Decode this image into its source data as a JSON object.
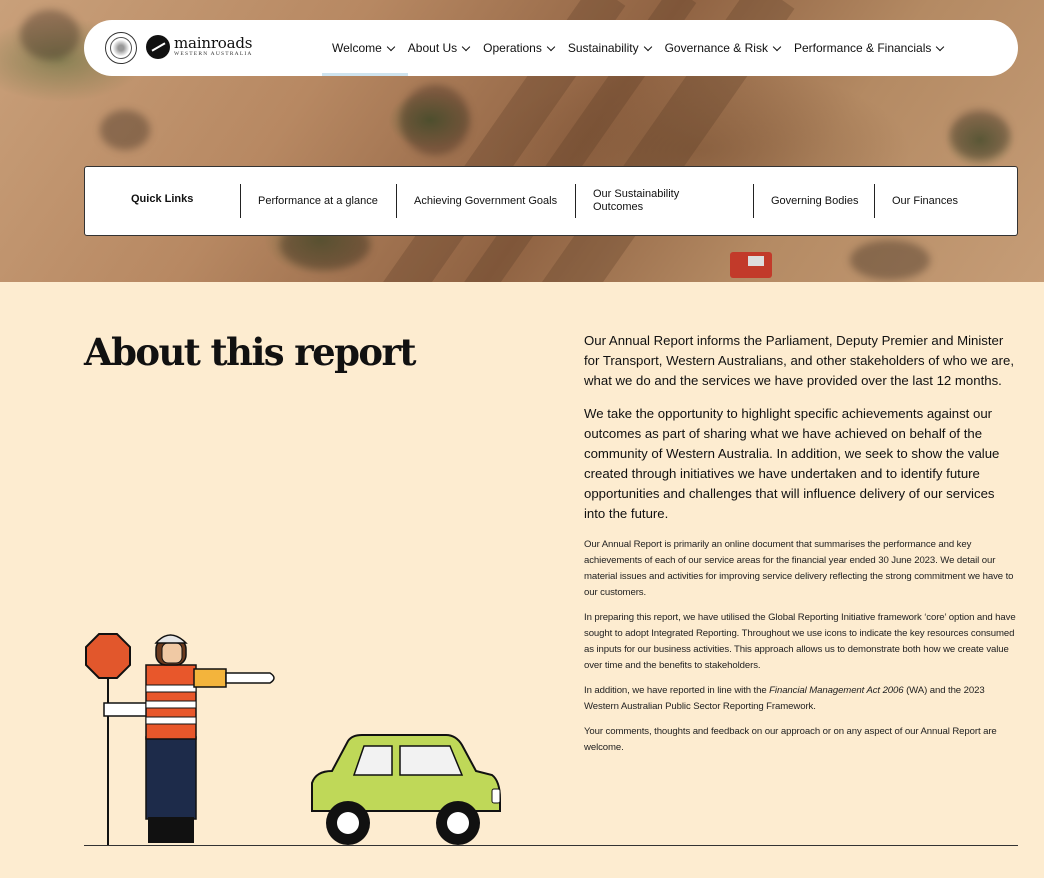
{
  "nav": {
    "items": [
      {
        "label": "Welcome",
        "active": true
      },
      {
        "label": "About Us"
      },
      {
        "label": "Operations"
      },
      {
        "label": "Sustainability"
      },
      {
        "label": "Governance & Risk"
      },
      {
        "label": "Performance & Financials"
      }
    ],
    "logo_text": "mainroads",
    "logo_subtext": "WESTERN AUSTRALIA"
  },
  "quick_links": {
    "title": "Quick Links",
    "items": [
      "Performance at a glance",
      "Achieving Government Goals",
      "Our Sustainability Outcomes",
      "Governing Bodies",
      "Our Finances"
    ]
  },
  "main": {
    "title": "About this report",
    "lead1": "Our Annual Report informs the Parliament, Deputy Premier and Minister for Transport, Western Australians, and other stakeholders of who we are, what we do and the services we have provided over the last 12 months.",
    "lead2": "We take the opportunity to highlight specific achievements against our outcomes as part of sharing what we have achieved on behalf of the community of Western Australia. In addition, we seek to show the value created through initiatives we have undertaken and to identify future opportunities and challenges that will influence delivery of our services into the future.",
    "body1": "Our Annual Report is primarily an online document that summarises the performance and key achievements of each of our service areas for the financial year ended 30 June 2023. We detail our material issues and activities for improving service delivery reflecting the strong commitment we have to our customers.",
    "body2": "In preparing this report, we have utilised the Global Reporting Initiative framework ‘core’ option and have sought to adopt Integrated Reporting. Throughout we use icons to indicate the key resources consumed as inputs for our business activities. This approach allows us to demonstrate both how we create value over time and the benefits to stakeholders.",
    "body3_pre": "In addition, we have reported in line with the ",
    "body3_italic": "Financial Management Act 2006",
    "body3_post": " (WA) and the 2023 Western Australian Public Sector Reporting Framework.",
    "body4": "Your comments, thoughts and feedback on our approach or on any aspect of our Annual Report are welcome."
  }
}
